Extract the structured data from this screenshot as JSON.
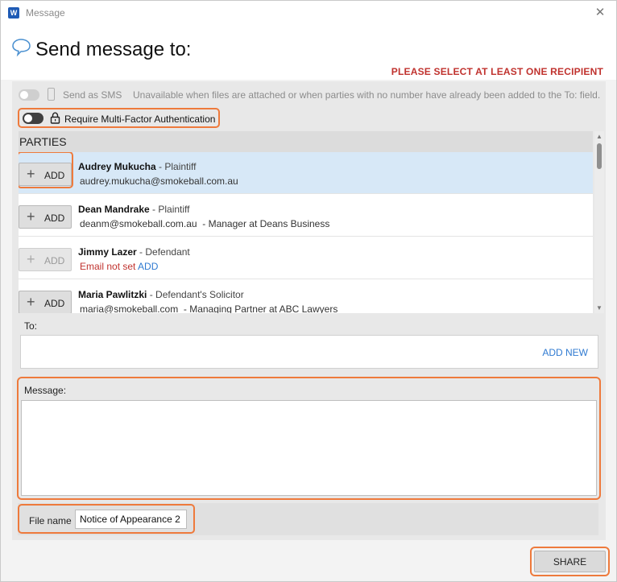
{
  "window": {
    "title": "Message",
    "app_icon_letter": "W",
    "close_glyph": "✕"
  },
  "header": {
    "heading": "Send message to:",
    "warning": "PLEASE SELECT AT LEAST ONE RECIPIENT"
  },
  "sms": {
    "label": "Send as SMS",
    "note": "Unavailable when files are attached or when parties with no number have already been added to the To: field.",
    "enabled": false
  },
  "mfa": {
    "label": "Require Multi-Factor Authentication",
    "enabled": false
  },
  "parties": {
    "header": "PARTIES",
    "add_label": "ADD",
    "items": [
      {
        "name": "Audrey Mukucha",
        "role": " - Plaintiff",
        "email": "audrey.mukucha@smokeball.com.au",
        "extra": "",
        "selected": true
      },
      {
        "name": "Dean Mandrake",
        "role": " - Plaintiff",
        "email": "deanm@smokeball.com.au",
        "extra": "  - Manager at Deans Business",
        "selected": false
      },
      {
        "name": "Jimmy Lazer",
        "role": " - Defendant",
        "email_unset": "Email not set",
        "add_link": "ADD",
        "selected": false
      },
      {
        "name": "Maria Pawlitzki",
        "role": " - Defendant's Solicitor",
        "email": "maria@smokeball.com",
        "extra": "  - Managing Partner at ABC Lawyers",
        "selected": false
      }
    ]
  },
  "to": {
    "label": "To:",
    "add_new": "ADD NEW"
  },
  "message": {
    "label": "Message:",
    "value": ""
  },
  "file": {
    "label": "File name",
    "value": "Notice of Appearance 2"
  },
  "actions": {
    "share": "SHARE"
  },
  "colors": {
    "accent_highlight": "#ee7a3c",
    "warning": "#c0322e",
    "link": "#2f7ad1",
    "selected_row": "#d7e8f7"
  }
}
